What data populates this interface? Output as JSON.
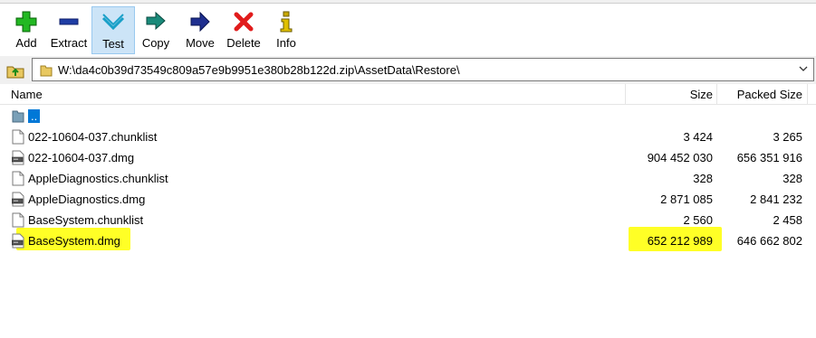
{
  "toolbar": {
    "buttons": [
      {
        "label": "Add",
        "icon": "plus-icon",
        "color": "#1ea51e"
      },
      {
        "label": "Extract",
        "icon": "minus-icon",
        "color": "#1f3ea5"
      },
      {
        "label": "Test",
        "icon": "check-chevron-icon",
        "color": "#1aa0c8",
        "pressed": true
      },
      {
        "label": "Copy",
        "icon": "double-arrow-icon",
        "color": "#1a7a6a"
      },
      {
        "label": "Move",
        "icon": "arrow-right-icon",
        "color": "#1f2f8f"
      },
      {
        "label": "Delete",
        "icon": "x-icon",
        "color": "#e11c1c"
      },
      {
        "label": "Info",
        "icon": "info-icon",
        "color": "#c8a800"
      }
    ]
  },
  "address": {
    "path": "W:\\da4c0b39d73549c809a57e9b9951e380b28b122d.zip\\AssetData\\Restore\\"
  },
  "columns": {
    "name": "Name",
    "size": "Size",
    "packed": "Packed Size"
  },
  "files": [
    {
      "name": "..",
      "size": "",
      "packed": "",
      "type": "folder-up"
    },
    {
      "name": "022-10604-037.chunklist",
      "size": "3 424",
      "packed": "3 265",
      "type": "file"
    },
    {
      "name": "022-10604-037.dmg",
      "size": "904 452 030",
      "packed": "656 351 916",
      "type": "disk"
    },
    {
      "name": "AppleDiagnostics.chunklist",
      "size": "328",
      "packed": "328",
      "type": "file"
    },
    {
      "name": "AppleDiagnostics.dmg",
      "size": "2 871 085",
      "packed": "2 841 232",
      "type": "disk"
    },
    {
      "name": "BaseSystem.chunklist",
      "size": "2 560",
      "packed": "2 458",
      "type": "file"
    },
    {
      "name": "BaseSystem.dmg",
      "size": "652 212 989",
      "packed": "646 662 802",
      "type": "disk",
      "highlighted": true
    }
  ],
  "colors": {
    "highlight": "#ffff00",
    "pressed_bg": "#cce4f7",
    "selection": "#0078d7"
  }
}
